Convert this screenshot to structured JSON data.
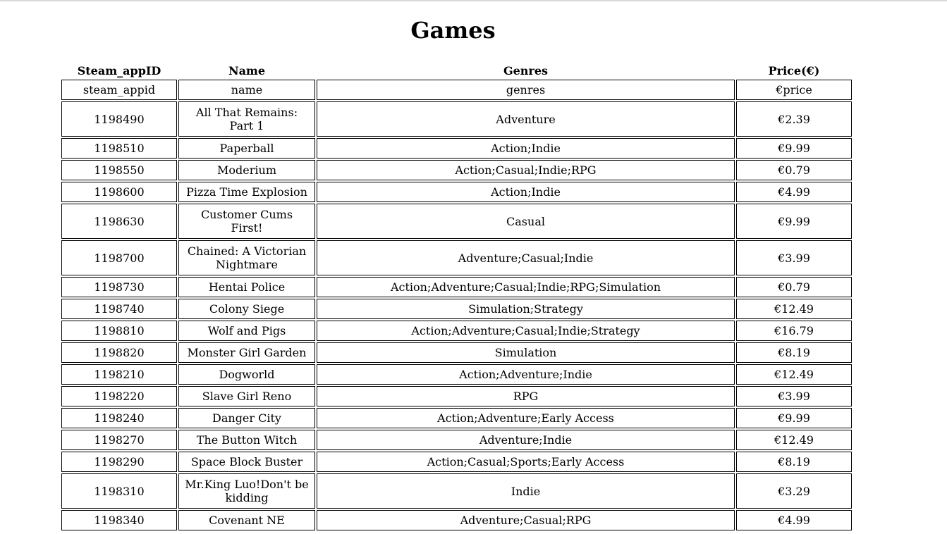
{
  "page": {
    "title": "Games"
  },
  "table": {
    "headers": {
      "id": "Steam_appID",
      "name": "Name",
      "genres": "Genres",
      "price": "Price(€)"
    },
    "rows": [
      {
        "id": "steam_appid",
        "name": "name",
        "genres": "genres",
        "price": "€price"
      },
      {
        "id": "1198490",
        "name": "All That Remains: Part 1",
        "genres": "Adventure",
        "price": "€2.39"
      },
      {
        "id": "1198510",
        "name": "Paperball",
        "genres": "Action;Indie",
        "price": "€9.99"
      },
      {
        "id": "1198550",
        "name": "Moderium",
        "genres": "Action;Casual;Indie;RPG",
        "price": "€0.79"
      },
      {
        "id": "1198600",
        "name": "Pizza Time Explosion",
        "genres": "Action;Indie",
        "price": "€4.99"
      },
      {
        "id": "1198630",
        "name": "Customer Cums First!",
        "genres": "Casual",
        "price": "€9.99"
      },
      {
        "id": "1198700",
        "name": "Chained: A Victorian Nightmare",
        "genres": "Adventure;Casual;Indie",
        "price": "€3.99"
      },
      {
        "id": "1198730",
        "name": "Hentai Police",
        "genres": "Action;Adventure;Casual;Indie;RPG;Simulation",
        "price": "€0.79"
      },
      {
        "id": "1198740",
        "name": "Colony Siege",
        "genres": "Simulation;Strategy",
        "price": "€12.49"
      },
      {
        "id": "1198810",
        "name": "Wolf and Pigs",
        "genres": "Action;Adventure;Casual;Indie;Strategy",
        "price": "€16.79"
      },
      {
        "id": "1198820",
        "name": "Monster Girl Garden",
        "genres": "Simulation",
        "price": "€8.19"
      },
      {
        "id": "1198210",
        "name": "Dogworld",
        "genres": "Action;Adventure;Indie",
        "price": "€12.49"
      },
      {
        "id": "1198220",
        "name": "Slave Girl Reno",
        "genres": "RPG",
        "price": "€3.99"
      },
      {
        "id": "1198240",
        "name": "Danger City",
        "genres": "Action;Adventure;Early Access",
        "price": "€9.99"
      },
      {
        "id": "1198270",
        "name": "The Button Witch",
        "genres": "Adventure;Indie",
        "price": "€12.49"
      },
      {
        "id": "1198290",
        "name": "Space Block Buster",
        "genres": "Action;Casual;Sports;Early Access",
        "price": "€8.19"
      },
      {
        "id": "1198310",
        "name": "Mr.King Luo!Don't be kidding",
        "genres": "Indie",
        "price": "€3.29"
      },
      {
        "id": "1198340",
        "name": "Covenant NE",
        "genres": "Adventure;Casual;RPG",
        "price": "€4.99"
      }
    ]
  }
}
